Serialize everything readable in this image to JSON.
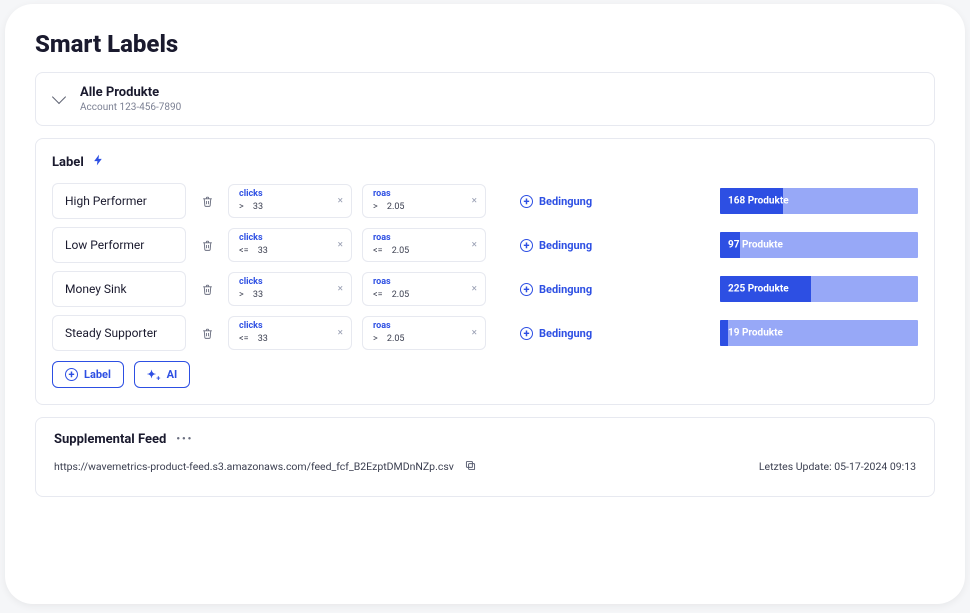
{
  "page_title": "Smart Labels",
  "account": {
    "title": "Alle Produkte",
    "sub": "Account 123-456-7890"
  },
  "label_section": {
    "heading": "Label"
  },
  "common": {
    "add_condition_label": "Bedingung",
    "products_word": "Produkte",
    "add_label_btn": "Label",
    "ai_btn": "AI"
  },
  "labels": [
    {
      "name": "High Performer",
      "conditions": [
        {
          "metric": "clicks",
          "op": ">",
          "value": "33"
        },
        {
          "metric": "roas",
          "op": ">",
          "value": "2.05"
        }
      ],
      "product_count": 168,
      "fill_pct": 32
    },
    {
      "name": "Low Performer",
      "conditions": [
        {
          "metric": "clicks",
          "op": "<=",
          "value": "33"
        },
        {
          "metric": "roas",
          "op": "<=",
          "value": "2.05"
        }
      ],
      "product_count": 97,
      "fill_pct": 10
    },
    {
      "name": "Money Sink",
      "conditions": [
        {
          "metric": "clicks",
          "op": ">",
          "value": "33"
        },
        {
          "metric": "roas",
          "op": "<=",
          "value": "2.05"
        }
      ],
      "product_count": 225,
      "fill_pct": 46
    },
    {
      "name": "Steady Supporter",
      "conditions": [
        {
          "metric": "clicks",
          "op": "<=",
          "value": "33"
        },
        {
          "metric": "roas",
          "op": ">",
          "value": "2.05"
        }
      ],
      "product_count": 19,
      "fill_pct": 4
    }
  ],
  "feed": {
    "title": "Supplemental Feed",
    "url": "https://wavemetrics-product-feed.s3.amazonaws.com/feed_fcf_B2EzptDMDnNZp.csv",
    "last_update_label": "Letztes Update:",
    "last_update_value": "05-17-2024 09:13"
  }
}
